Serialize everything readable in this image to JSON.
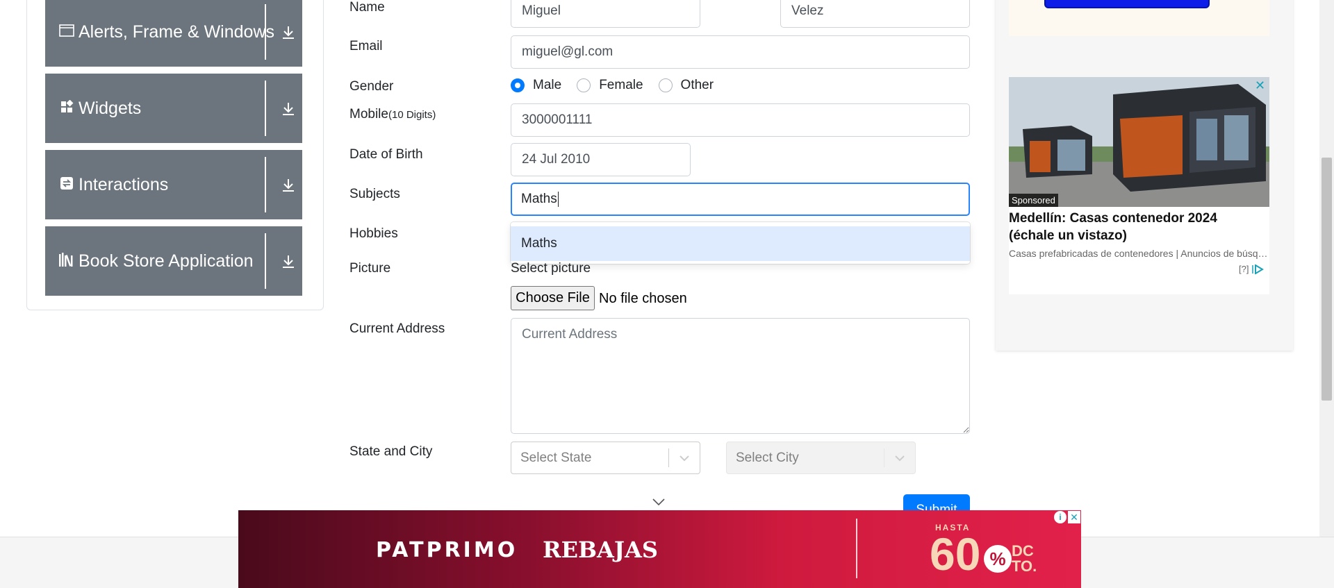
{
  "sidebar": {
    "groups": [
      {
        "title": "Alerts, Frame & Windows",
        "icon": "window-icon"
      },
      {
        "title": "Widgets",
        "icon": "widgets-icon"
      },
      {
        "title": "Interactions",
        "icon": "interactions-icon"
      },
      {
        "title": "Book Store Application",
        "icon": "books-icon"
      }
    ]
  },
  "form": {
    "name_label": "Name",
    "first_name_value": "Miguel",
    "last_name_value": "Velez",
    "email_label": "Email",
    "email_value": "miguel@gl.com",
    "gender_label": "Gender",
    "gender_options": [
      "Male",
      "Female",
      "Other"
    ],
    "gender_selected": "Male",
    "mobile_label": "Mobile",
    "mobile_hint": "(10 Digits)",
    "mobile_value": "3000001111",
    "dob_label": "Date of Birth",
    "dob_value": "24 Jul 2010",
    "subjects_label": "Subjects",
    "subjects_value": "Maths",
    "subjects_suggestion": "Maths",
    "hobbies_label": "Hobbies",
    "picture_label": "Picture",
    "picture_hint": "Select picture",
    "file_button": "Choose File",
    "file_status": "No file chosen",
    "address_label": "Current Address",
    "address_placeholder": "Current Address",
    "state_city_label": "State and City",
    "state_placeholder": "Select State",
    "city_placeholder": "Select City",
    "submit_label": "Submit"
  },
  "ad": {
    "sponsored": "Sponsored",
    "headline": "Medellín: Casas contenedor 2024 (échale un vistazo)",
    "sub": "Casas prefabricadas de contenedores | Anuncios de búsqueda",
    "choices": "[?]"
  },
  "banner": {
    "brand1": "PATPRIMO",
    "brand2": "REBAJAS",
    "hasta": "HASTA",
    "percent": "60",
    "percent_sign": "%",
    "dcto_line1": "DC",
    "dcto_line2": "TO."
  },
  "colors": {
    "sidebar_group_bg": "#6c757d",
    "primary": "#007bff",
    "focus_border": "#2684ff",
    "option_highlight": "#deebff",
    "banner_red": "#cf1a3e"
  }
}
